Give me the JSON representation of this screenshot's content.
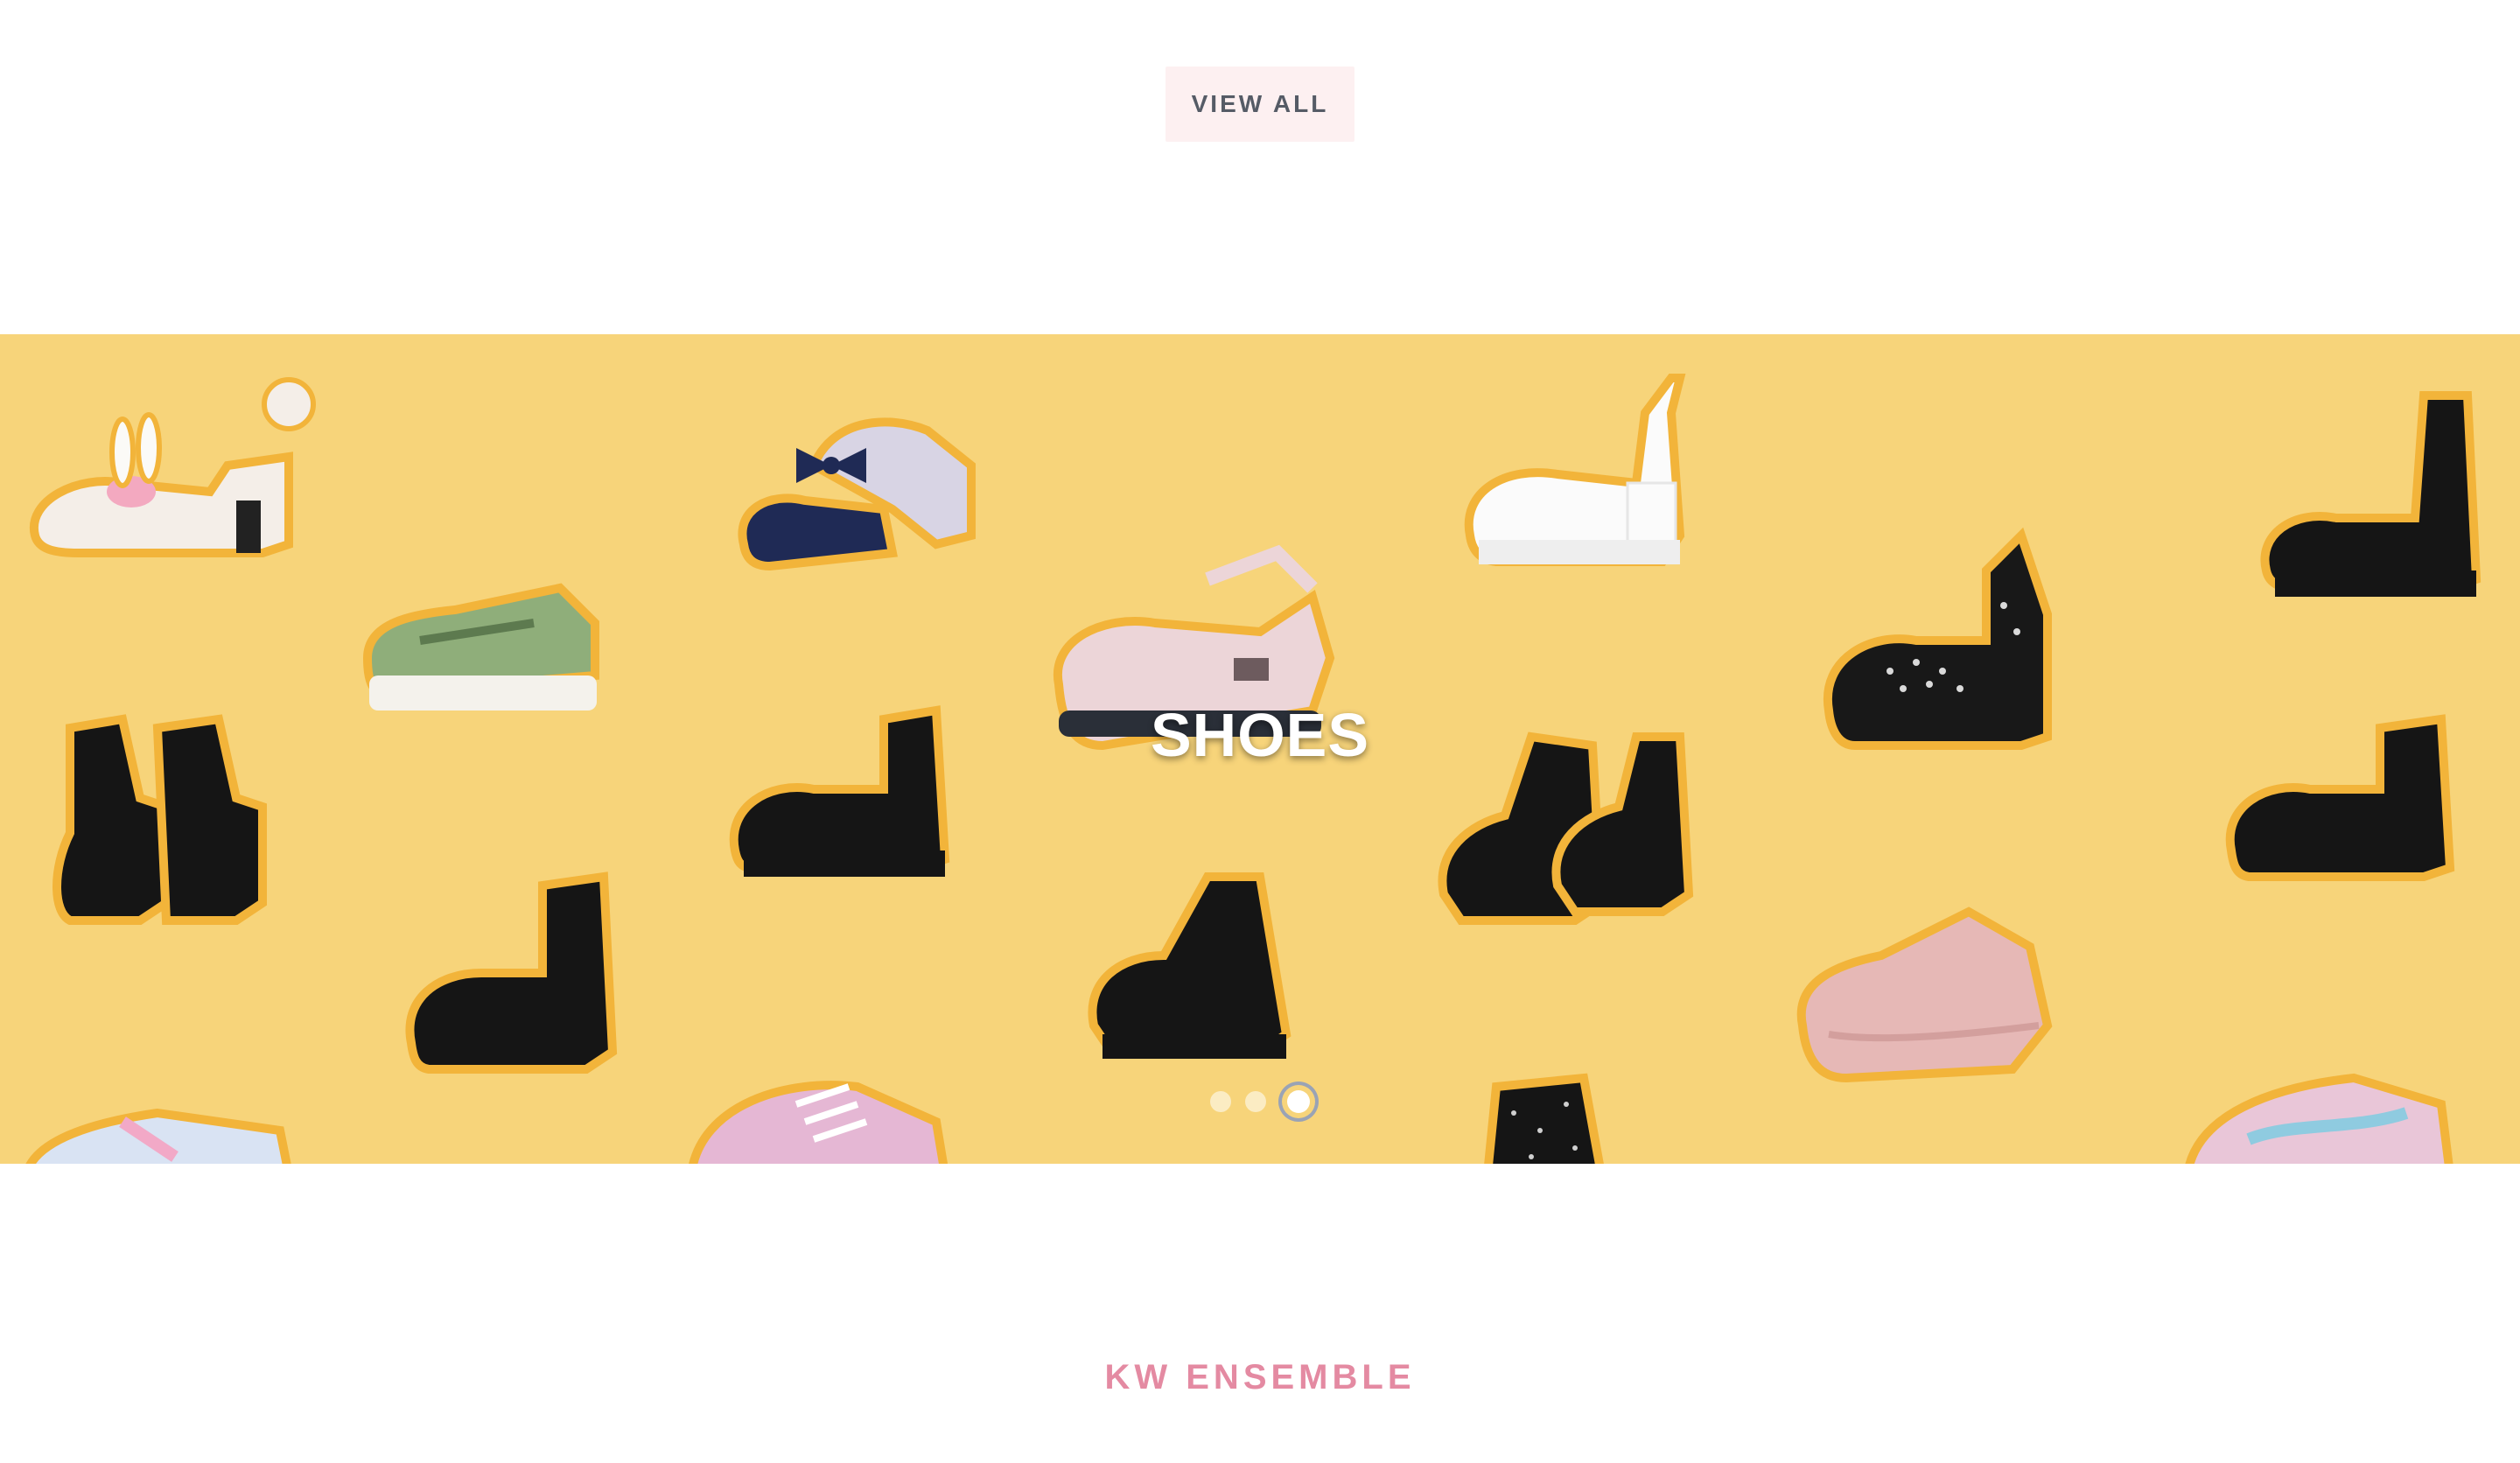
{
  "view_all": {
    "label": "VIEW ALL"
  },
  "banner": {
    "title": "SHOES",
    "slides_count": 3,
    "active_slide": 3,
    "background_color": "#f7d47a",
    "outline_color": "#f2b43a"
  },
  "section": {
    "heading": "KW ENSEMBLE",
    "heading_color": "#e48aa2"
  }
}
